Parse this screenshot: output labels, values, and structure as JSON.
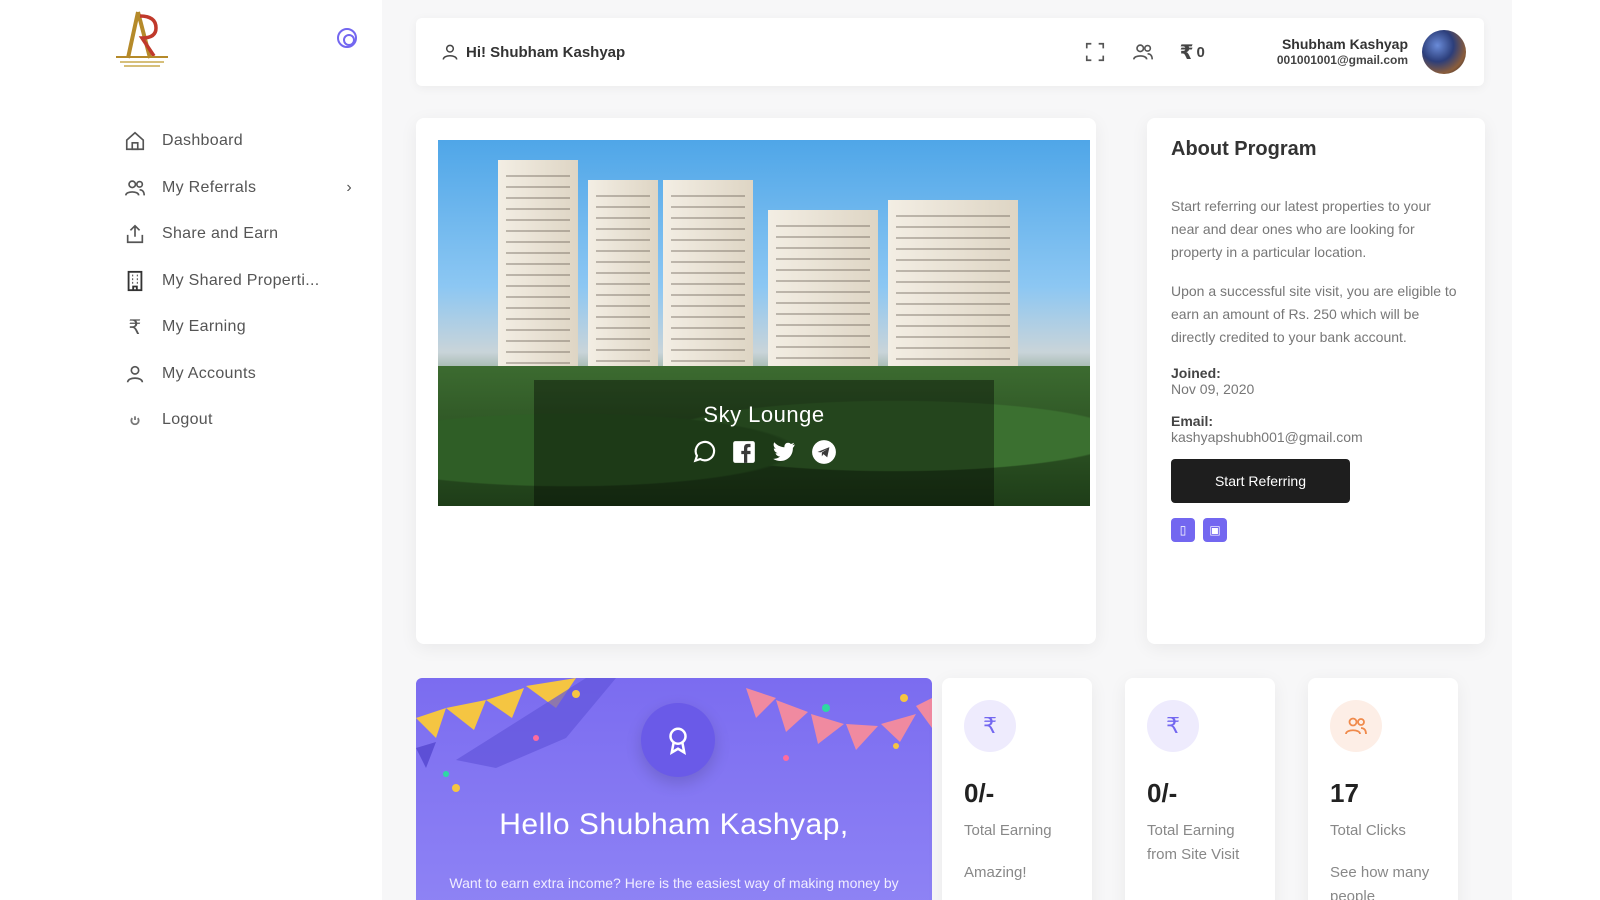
{
  "sidebar": {
    "items": [
      {
        "label": "Dashboard",
        "icon": "home-icon"
      },
      {
        "label": "My Referrals",
        "icon": "users-icon",
        "has_submenu": true
      },
      {
        "label": "Share and Earn",
        "icon": "share-icon"
      },
      {
        "label": "My Shared Properti...",
        "icon": "building-icon"
      },
      {
        "label": "My Earning",
        "icon": "rupee-icon"
      },
      {
        "label": "My Accounts",
        "icon": "user-icon"
      },
      {
        "label": "Logout",
        "icon": "power-icon"
      }
    ],
    "chevron": "›"
  },
  "header": {
    "greeting": "Hi! Shubham Kashyap",
    "wallet_symbol": "₹",
    "wallet_amount": "0",
    "user_name": "Shubham Kashyap",
    "user_email": "001001001@gmail.com"
  },
  "banner": {
    "title": "Sky Lounge"
  },
  "about": {
    "title": "About Program",
    "para1": "Start referring our latest properties to your near and dear ones who are looking for property in a particular location.",
    "para2": "Upon a successful site visit, you are eligible to earn an amount of Rs. 250 which will be directly credited to your bank account.",
    "joined_label": "Joined:",
    "joined_value": "Nov 09, 2020",
    "email_label": "Email:",
    "email_value": "kashyapshubh001@gmail.com",
    "button_label": "Start Referring"
  },
  "hello": {
    "title": "Hello Shubham Kashyap,",
    "subtitle": "Want to earn extra income? Here is the easiest way of making money by just referring properties. So why are"
  },
  "stats": [
    {
      "icon_symbol": "₹",
      "value": "0/-",
      "label": "Total Earning",
      "desc": "Amazing!"
    },
    {
      "icon_symbol": "₹",
      "value": "0/-",
      "label": "Total Earning from Site Visit",
      "desc": ""
    },
    {
      "icon_symbol": "👥",
      "value": "17",
      "label": "Total Clicks",
      "desc": "See how many people"
    }
  ],
  "colors": {
    "accent": "#7367f0",
    "dark_button": "#1e1e1e",
    "stat_icon_bg_purple": "#eeebfd",
    "stat_icon_bg_orange": "#fdeee6"
  }
}
